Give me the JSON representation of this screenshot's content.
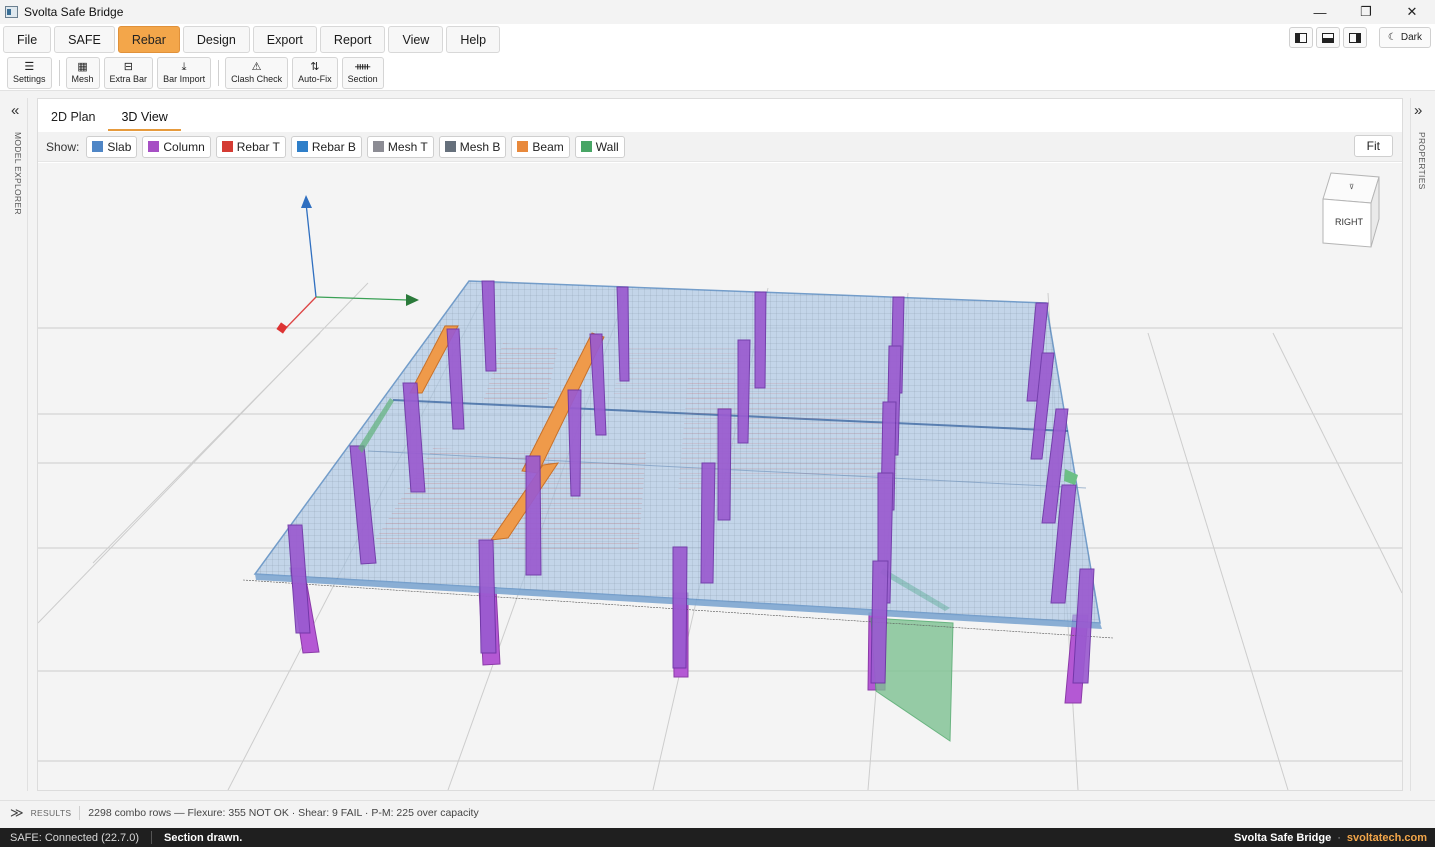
{
  "window": {
    "title": "Svolta Safe Bridge",
    "controls": [
      "—",
      "❐",
      "✕"
    ]
  },
  "menu": {
    "items": [
      "File",
      "SAFE",
      "Rebar",
      "Design",
      "Export",
      "Report",
      "View",
      "Help"
    ],
    "active": "Rebar",
    "theme_label": "Dark"
  },
  "toolbar": {
    "buttons": [
      {
        "label": "Settings",
        "icon": "sliders-icon"
      },
      {
        "label": "Mesh",
        "icon": "grid-icon"
      },
      {
        "label": "Extra Bar",
        "icon": "bar-icon"
      },
      {
        "label": "Bar Import",
        "icon": "download-icon"
      },
      {
        "label": "Clash Check",
        "icon": "warning-icon"
      },
      {
        "label": "Auto-Fix",
        "icon": "arrows-icon"
      },
      {
        "label": "Section",
        "icon": "section-icon"
      }
    ]
  },
  "panels": {
    "left_label": "MODEL EXPLORER",
    "right_label": "PROPERTIES"
  },
  "tabs": [
    "2D Plan",
    "3D View"
  ],
  "active_tab": "3D View",
  "show": {
    "label": "Show:",
    "chips": [
      {
        "label": "Slab",
        "color": "#4f86c6"
      },
      {
        "label": "Column",
        "color": "#a64fc4"
      },
      {
        "label": "Rebar T",
        "color": "#d43b33"
      },
      {
        "label": "Rebar B",
        "color": "#2f7fc9"
      },
      {
        "label": "Mesh T",
        "color": "#8c8c94"
      },
      {
        "label": "Mesh B",
        "color": "#66707c"
      },
      {
        "label": "Beam",
        "color": "#e8893c"
      },
      {
        "label": "Wall",
        "color": "#48a565"
      }
    ],
    "fit_label": "Fit"
  },
  "viewcube": {
    "face_label": "RIGHT"
  },
  "results": {
    "label": "RESULTS",
    "summary": "2298 combo rows — Flexure: 355 NOT OK · Shear: 9 FAIL · P-M: 225 over capacity"
  },
  "status": {
    "connection": "SAFE: Connected (22.7.0)",
    "message": "Section drawn.",
    "brand": "Svolta Safe Bridge",
    "site": "svoltatech.com"
  }
}
